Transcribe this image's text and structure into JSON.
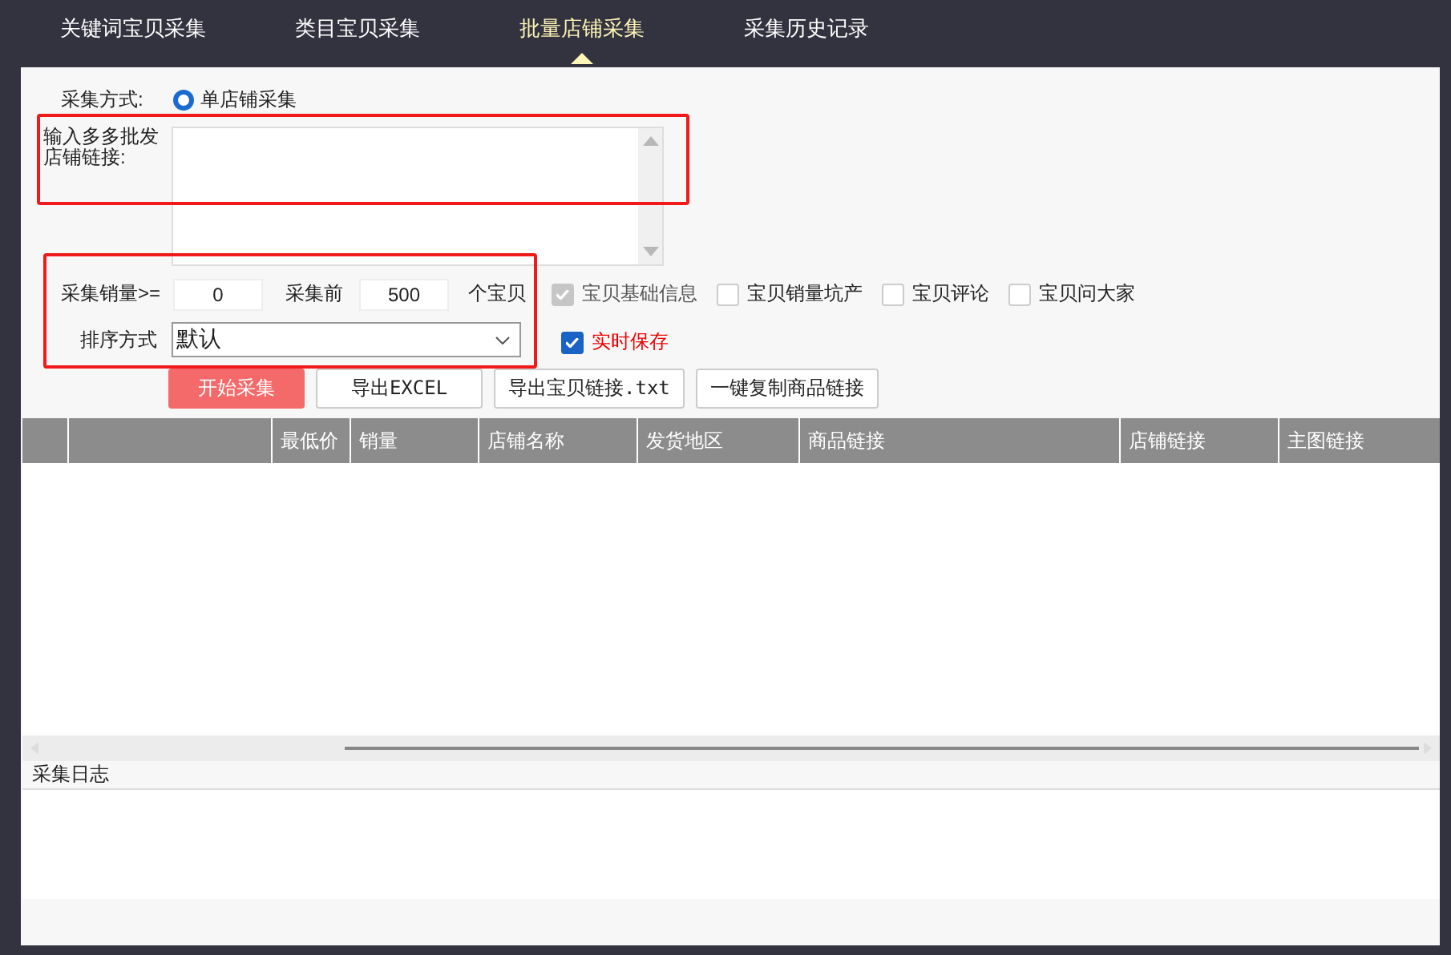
{
  "tabs": [
    {
      "label": "关键词宝贝采集",
      "selected": false
    },
    {
      "label": "类目宝贝采集",
      "selected": false
    },
    {
      "label": "批量店铺采集",
      "selected": true
    },
    {
      "label": "采集历史记录",
      "selected": false
    }
  ],
  "mode": {
    "label": "采集方式:",
    "options": [
      {
        "label": "单店铺采集",
        "selected": true
      }
    ]
  },
  "links": {
    "label": "输入多多批发店铺链接:"
  },
  "min_sales": {
    "label": "采集销量>=",
    "value": "0"
  },
  "limit": {
    "label": "采集前",
    "value": "500",
    "unit": "个宝贝"
  },
  "sort": {
    "label": "排序方式",
    "value": "默认"
  },
  "options": [
    {
      "label": "宝贝基础信息",
      "checked": true,
      "disabled": true,
      "alert": false
    },
    {
      "label": "宝贝销量坑产",
      "checked": false,
      "disabled": false,
      "alert": false
    },
    {
      "label": "宝贝评论",
      "checked": false,
      "disabled": false,
      "alert": false
    },
    {
      "label": "宝贝问大家",
      "checked": false,
      "disabled": false,
      "alert": false
    }
  ],
  "realtime_save": {
    "label": "实时保存",
    "checked": true,
    "disabled": false,
    "alert": true
  },
  "buttons": [
    {
      "label": "开始采集",
      "kind": "primary"
    },
    {
      "label": "导出EXCEL",
      "kind": "plain"
    },
    {
      "label": "导出宝贝链接.txt",
      "kind": "plain"
    },
    {
      "label": "一键复制商品链接",
      "kind": "plain"
    }
  ],
  "table": {
    "columns": [
      "最低价",
      "销量",
      "店铺名称",
      "发货地区",
      "商品链接",
      "店铺链接",
      "主图链接"
    ]
  },
  "log": {
    "title": "采集日志"
  }
}
